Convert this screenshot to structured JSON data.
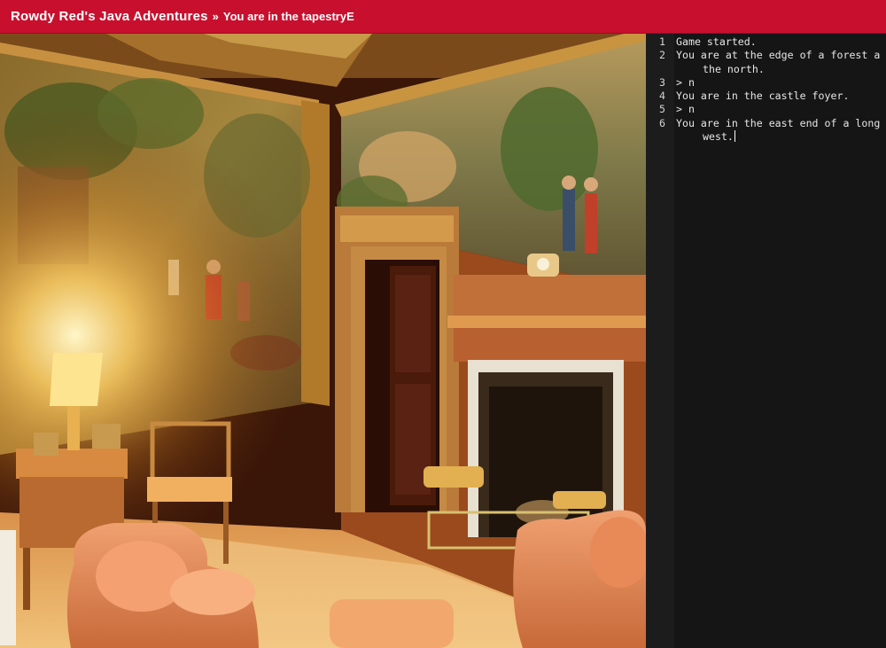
{
  "header": {
    "app_title": "Rowdy Red's Java Adventures",
    "separator": "»",
    "room_title": "You are in the tapestryE"
  },
  "scene": {
    "description_icon": "tapestry-room-image"
  },
  "terminal": {
    "lines": [
      {
        "num": "1",
        "text": "Game started.",
        "cont": ""
      },
      {
        "num": "2",
        "text": "You are at the edge of a forest a",
        "cont": "the north."
      },
      {
        "num": "3",
        "text": "> n",
        "cont": ""
      },
      {
        "num": "4",
        "text": "You are in the castle foyer.",
        "cont": ""
      },
      {
        "num": "5",
        "text": "> n",
        "cont": ""
      },
      {
        "num": "6",
        "text": "You are in the east end of a long",
        "cont": "west."
      }
    ]
  },
  "colors": {
    "header_bg": "#c8102e",
    "terminal_bg": "#151515",
    "gutter_bg": "#1c1c1c"
  }
}
